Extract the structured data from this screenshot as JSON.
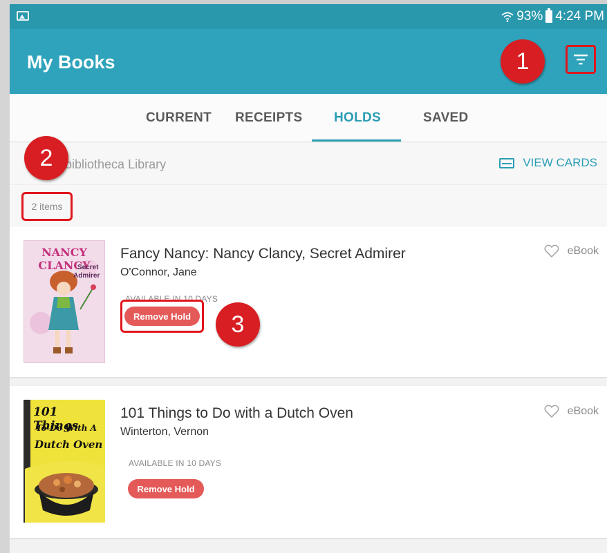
{
  "status_bar": {
    "battery": "93%",
    "time": "4:24 PM"
  },
  "app_bar": {
    "title": "My Books"
  },
  "tabs": [
    {
      "label": "CURRENT"
    },
    {
      "label": "RECEIPTS"
    },
    {
      "label": "HOLDS"
    },
    {
      "label": "SAVED"
    }
  ],
  "active_tab": "HOLDS",
  "library": {
    "name": "bibliotheca Library",
    "view_cards_label": "VIEW CARDS"
  },
  "list": {
    "count_label": "2 items"
  },
  "annotations": [
    "1",
    "2",
    "3"
  ],
  "books": [
    {
      "title": "Fancy Nancy: Nancy Clancy, Secret Admirer",
      "author": "O'Connor, Jane",
      "availability": "AVAILABLE IN 10 DAYS",
      "action_label": "Remove Hold",
      "format": "eBook",
      "cover_text": {
        "line1": "NANCY CLANCY",
        "line2": "Secret",
        "line3": "Admirer"
      }
    },
    {
      "title": "101 Things to Do with a Dutch Oven",
      "author": "Winterton, Vernon",
      "availability": "AVAILABLE IN 10 DAYS",
      "action_label": "Remove Hold",
      "format": "eBook",
      "cover_text": {
        "line1": "101 Things",
        "line2": "To Do With A",
        "line3": "Dutch Oven"
      }
    }
  ],
  "colors": {
    "app_bar": "#2fa3bb",
    "accent": "#2a9db5",
    "remove_button": "#e35a58",
    "annotation": "#d81e22"
  },
  "icons": [
    "image-icon",
    "wifi-icon",
    "battery-icon",
    "filter-icon",
    "card-icon",
    "heart-icon"
  ]
}
